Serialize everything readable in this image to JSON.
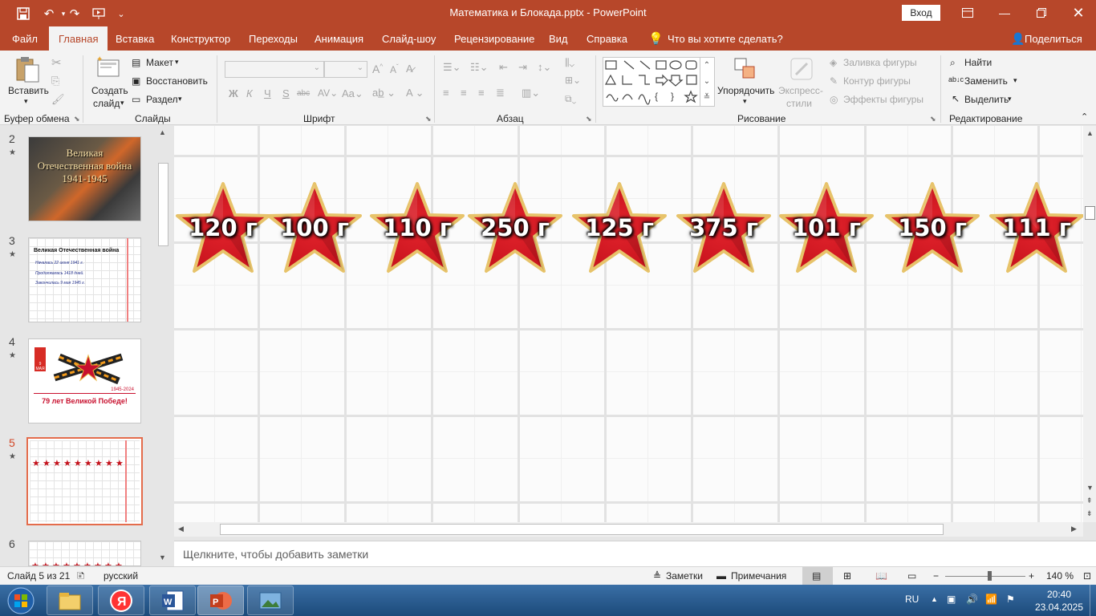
{
  "window": {
    "title": "Математика и Блокада.pptx  -  PowerPoint",
    "signin_label": "Вход"
  },
  "tabs": [
    {
      "label": "Файл"
    },
    {
      "label": "Главная"
    },
    {
      "label": "Вставка"
    },
    {
      "label": "Конструктор"
    },
    {
      "label": "Переходы"
    },
    {
      "label": "Анимация"
    },
    {
      "label": "Слайд-шоу"
    },
    {
      "label": "Рецензирование"
    },
    {
      "label": "Вид"
    },
    {
      "label": "Справка"
    },
    {
      "label": "Что вы хотите сделать?"
    },
    {
      "label": "Поделиться"
    }
  ],
  "ribbon": {
    "clipboard": {
      "group": "Буфер обмена",
      "paste": "Вставить"
    },
    "slides": {
      "group": "Слайды",
      "new_slide_1": "Создать",
      "new_slide_2": "слайд",
      "layout": "Макет",
      "reset": "Восстановить",
      "section": "Раздел"
    },
    "font": {
      "group": "Шрифт",
      "bold": "Ж",
      "italic": "К",
      "underline": "Ч",
      "shadow": "S",
      "strike": "abc"
    },
    "paragraph": {
      "group": "Абзац"
    },
    "drawing": {
      "group": "Рисование",
      "arrange": "Упорядочить",
      "quick_styles_1": "Экспресс-",
      "quick_styles_2": "стили",
      "fill": "Заливка фигуры",
      "outline": "Контур фигуры",
      "effects": "Эффекты фигуры"
    },
    "editing": {
      "group": "Редактирование",
      "find": "Найти",
      "replace": "Заменить",
      "select": "Выделить"
    }
  },
  "thumbnails": [
    {
      "num": "2",
      "star": "★",
      "title": "Великая Отечественная война 1941-1945"
    },
    {
      "num": "3",
      "star": "★",
      "title": "Великая Отечественная война",
      "lines": [
        "Началась     22 июня 1941 г.",
        "Продолжалась     1418 дней.",
        "Закончилась     9 мая 1945 г."
      ]
    },
    {
      "num": "4",
      "star": "★",
      "badge": "9 МАЯ",
      "years": "1945-2024",
      "caption": "79 лет  Великой  Победе!"
    },
    {
      "num": "5",
      "star": "★"
    },
    {
      "num": "6"
    }
  ],
  "slide": {
    "stars": [
      {
        "label": "120 г"
      },
      {
        "label": "100 г"
      },
      {
        "label": "110 г"
      },
      {
        "label": "250 г"
      },
      {
        "label": "125 г"
      },
      {
        "label": "375 г"
      },
      {
        "label": "101 г"
      },
      {
        "label": "150 г"
      },
      {
        "label": "111 г"
      }
    ],
    "star_color": "#c4111b",
    "star_rim": "#e7c36a"
  },
  "notes": {
    "placeholder": "Щелкните, чтобы добавить заметки"
  },
  "status": {
    "slide_info": "Слайд 5 из 21",
    "language": "русский",
    "notes_btn": "Заметки",
    "comments_btn": "Примечания",
    "zoom": "140 %"
  },
  "taskbar": {
    "lang": "RU",
    "time": "20:40",
    "date": "23.04.2025"
  },
  "colors": {
    "accent": "#b7472a"
  }
}
